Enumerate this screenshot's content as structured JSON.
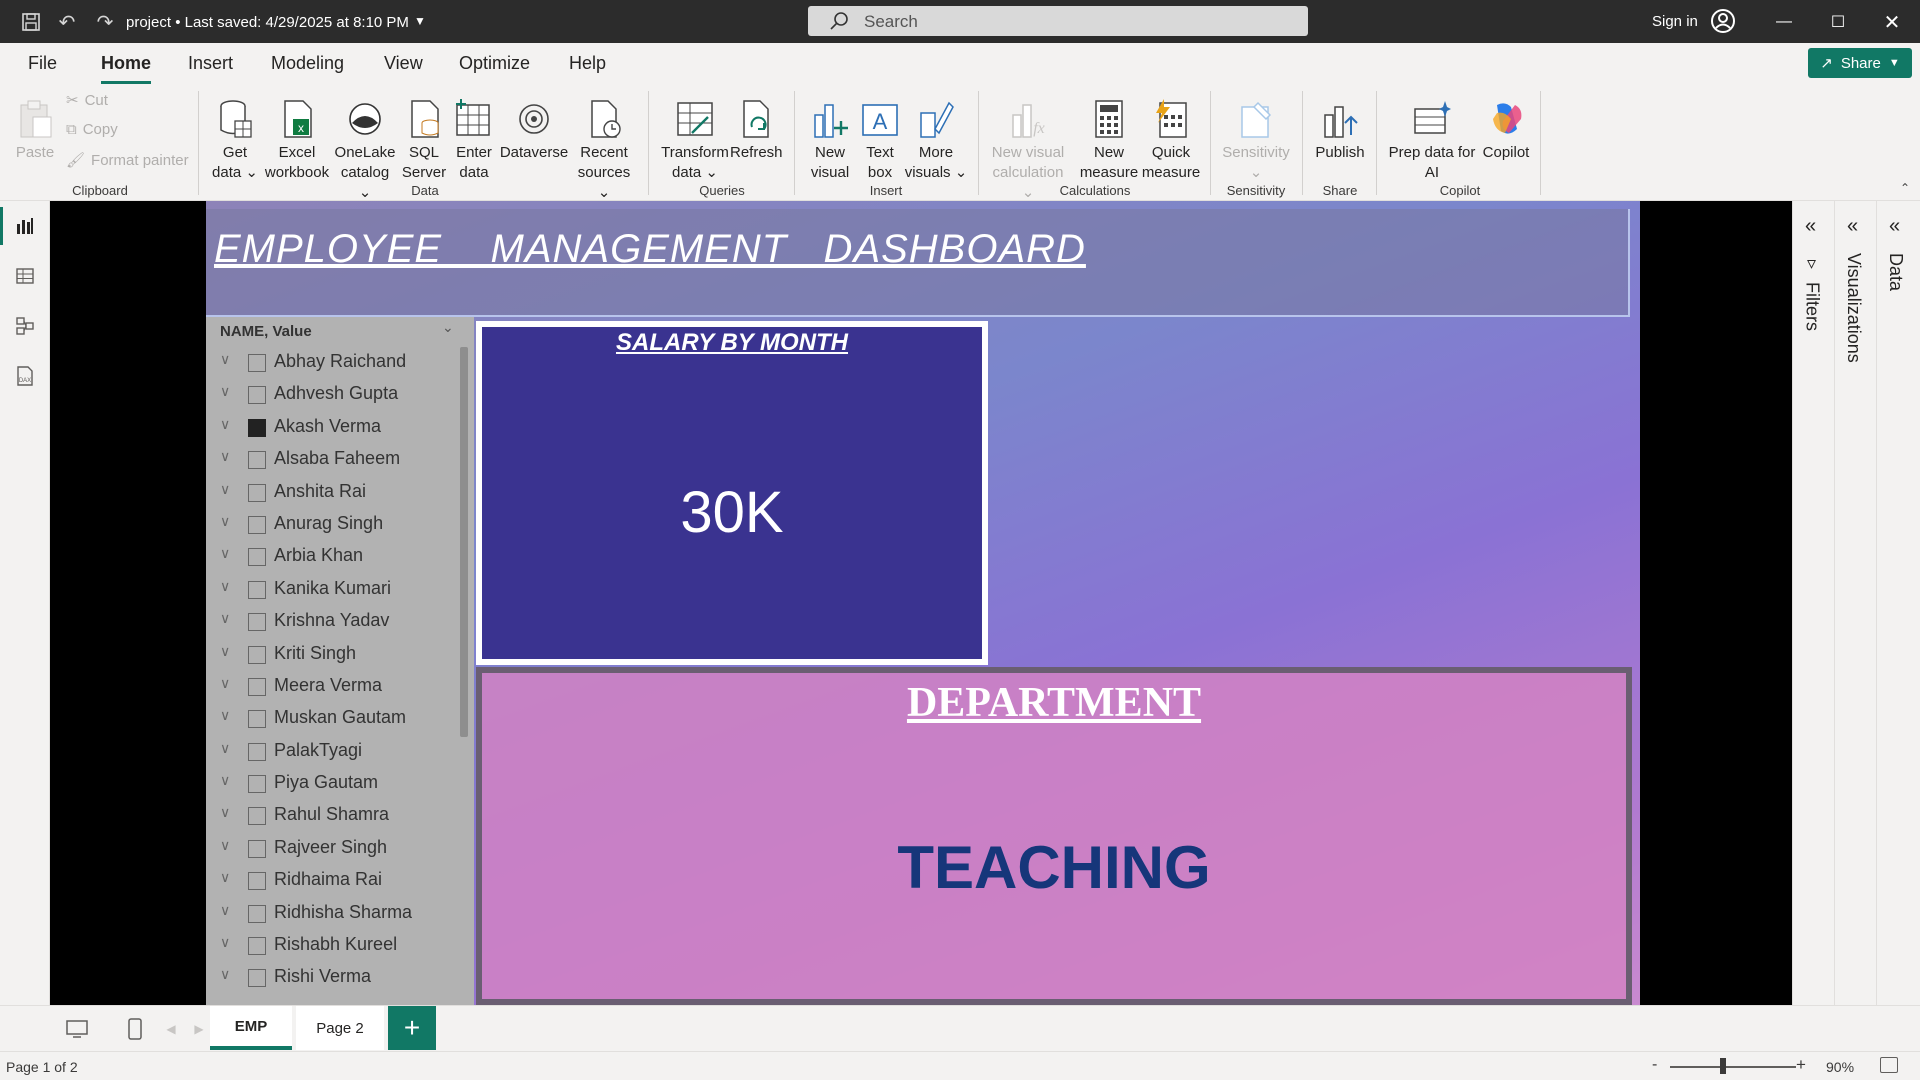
{
  "titlebar": {
    "doc_title": "project • Last saved: 4/29/2025 at 8:10 PM",
    "search_placeholder": "Search",
    "sign_in": "Sign in"
  },
  "menu_tabs": [
    "File",
    "Home",
    "Insert",
    "Modeling",
    "View",
    "Optimize",
    "Help"
  ],
  "active_tab": "Home",
  "share_label": "Share",
  "ribbon": {
    "clipboard": {
      "paste": "Paste",
      "cut": "Cut",
      "copy": "Copy",
      "format_painter": "Format painter",
      "group": "Clipboard"
    },
    "data": {
      "get_data": [
        "Get",
        "data ⌄"
      ],
      "excel": [
        "Excel",
        "workbook"
      ],
      "onelake": [
        "OneLake",
        "catalog ⌄"
      ],
      "sql": [
        "SQL",
        "Server"
      ],
      "enter": [
        "Enter",
        "data"
      ],
      "dataverse": [
        "Dataverse",
        ""
      ],
      "recent": [
        "Recent",
        "sources ⌄"
      ],
      "group": "Data"
    },
    "queries": {
      "transform": [
        "Transform",
        "data ⌄"
      ],
      "refresh": [
        "Refresh",
        ""
      ],
      "group": "Queries"
    },
    "insert": {
      "new_visual": [
        "New",
        "visual"
      ],
      "text_box": [
        "Text",
        "box"
      ],
      "more_visuals": [
        "More",
        "visuals ⌄"
      ],
      "group": "Insert"
    },
    "calculations": {
      "new_visual_calc": [
        "New visual",
        "calculation ⌄"
      ],
      "new_measure": [
        "New",
        "measure"
      ],
      "quick_measure": [
        "Quick",
        "measure"
      ],
      "group": "Calculations"
    },
    "sensitivity": {
      "label": [
        "Sensitivity",
        "⌄"
      ],
      "group": "Sensitivity"
    },
    "share": {
      "publish": [
        "Publish",
        ""
      ],
      "group": "Share"
    },
    "copilot": {
      "prep": [
        "Prep data for",
        "AI"
      ],
      "copilot": [
        "Copilot",
        ""
      ],
      "group": "Copilot"
    }
  },
  "report": {
    "header_title": "EMPLOYEE    MANAGEMENT   DASHBOARD",
    "slicer_header": "NAME, Value",
    "employees": [
      {
        "name": "Abhay Raichand",
        "checked": false
      },
      {
        "name": "Adhvesh Gupta",
        "checked": false
      },
      {
        "name": "Akash Verma",
        "checked": true
      },
      {
        "name": "Alsaba Faheem",
        "checked": false
      },
      {
        "name": "Anshita Rai",
        "checked": false
      },
      {
        "name": "Anurag Singh",
        "checked": false
      },
      {
        "name": "Arbia Khan",
        "checked": false
      },
      {
        "name": "Kanika Kumari",
        "checked": false
      },
      {
        "name": "Krishna Yadav",
        "checked": false
      },
      {
        "name": "Kriti Singh",
        "checked": false
      },
      {
        "name": "Meera Verma",
        "checked": false
      },
      {
        "name": "Muskan Gautam",
        "checked": false
      },
      {
        "name": "PalakTyagi",
        "checked": false
      },
      {
        "name": "Piya Gautam",
        "checked": false
      },
      {
        "name": "Rahul Shamra",
        "checked": false
      },
      {
        "name": "Rajveer Singh",
        "checked": false
      },
      {
        "name": "Ridhaima Rai",
        "checked": false
      },
      {
        "name": "Ridhisha Sharma",
        "checked": false
      },
      {
        "name": "Rishabh Kureel",
        "checked": false
      },
      {
        "name": "Rishi Verma",
        "checked": false
      }
    ],
    "salary_card": {
      "title": "SALARY BY MONTH",
      "value": "30K"
    },
    "department_card": {
      "title": "DEPARTMENT",
      "value": "TEACHING"
    }
  },
  "panes": {
    "filters": "Filters",
    "visualizations": "Visualizations",
    "data": "Data"
  },
  "pages": [
    {
      "label": "EMP",
      "active": true
    },
    {
      "label": "Page 2",
      "active": false
    }
  ],
  "status": {
    "page_indicator": "Page 1 of 2",
    "zoom": "90%"
  },
  "colors": {
    "accent": "#117865",
    "salary_card": "#3a3390",
    "department_value": "#16367a"
  }
}
